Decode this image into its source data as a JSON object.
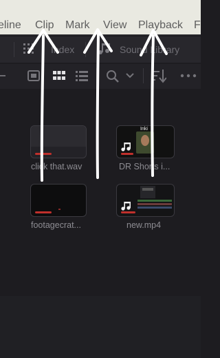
{
  "menubar": {
    "items": [
      "eline",
      "Clip",
      "Mark",
      "View",
      "Playback",
      "F"
    ]
  },
  "toolbar": {
    "index_label": "Index",
    "sound_library_label": "Sound Library"
  },
  "media": [
    {
      "name": "click that.wav",
      "type": "audio",
      "progress": 0.35
    },
    {
      "name": "DR Shorts i...",
      "type": "video",
      "progress": 0.25
    },
    {
      "name": "footagecrat...",
      "type": "video",
      "progress": 0.35
    },
    {
      "name": "new.mp4",
      "type": "video",
      "progress": 0.3
    }
  ],
  "thumb_dr_text": "Inki",
  "colors": {
    "menubar_bg": "#e9e9e1",
    "panel_bg": "#1d1c20",
    "accent_red": "#c0302c",
    "annotation_white": "#ffffff"
  }
}
